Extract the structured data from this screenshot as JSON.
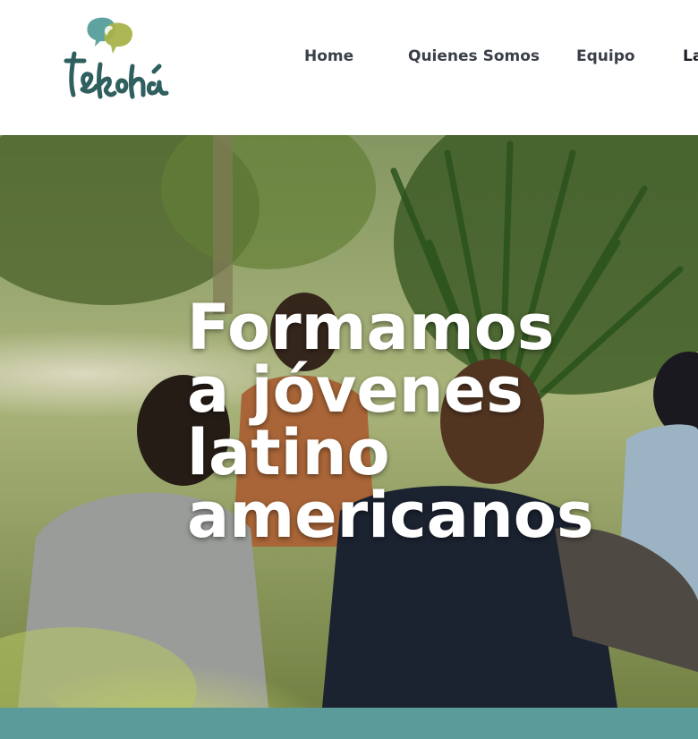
{
  "header": {
    "logo_text": "tekohá",
    "nav": [
      {
        "label": "Home"
      },
      {
        "label": "Quienes Somos"
      },
      {
        "label": "Equipo"
      },
      {
        "label": "La"
      }
    ]
  },
  "hero": {
    "headline_lines": [
      "Formamos",
      "a jóvenes",
      "latino",
      "americanos"
    ]
  },
  "colors": {
    "teal": "#5b9b99",
    "olive": "#9aa83a",
    "logo_dark": "#2f5f5e",
    "nav_text": "#3a3f4a"
  },
  "icons": [
    "logo-speech-bubbles-icon"
  ]
}
